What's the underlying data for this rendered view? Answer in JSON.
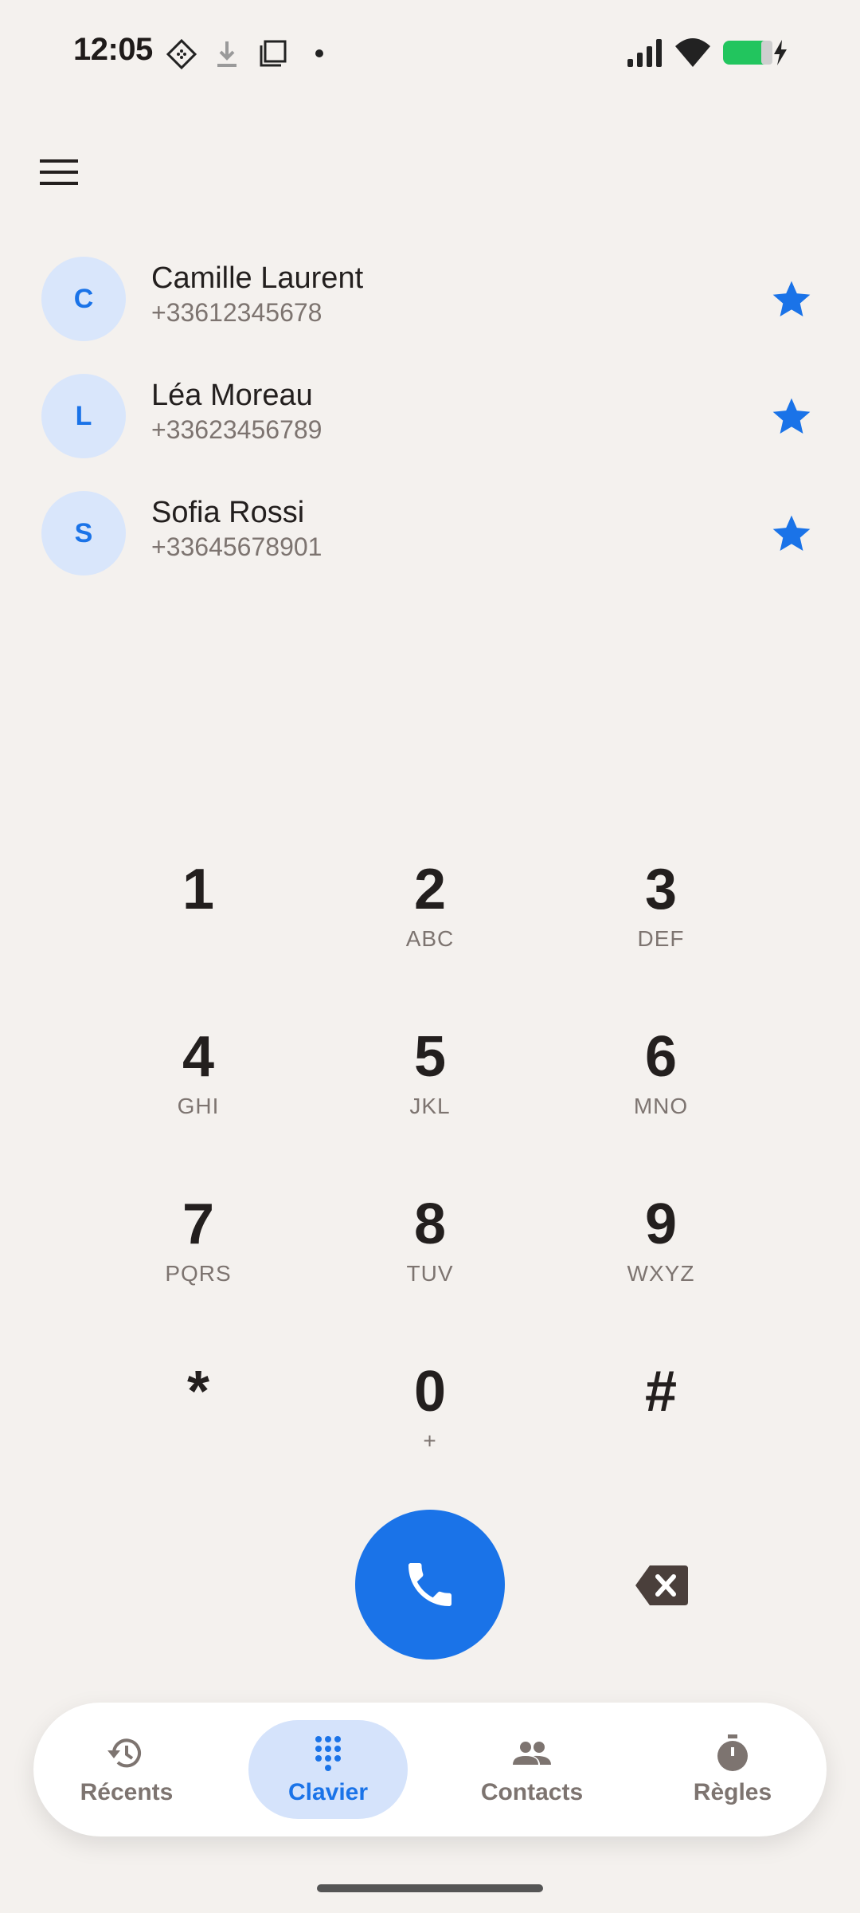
{
  "status_bar": {
    "time": "12:05"
  },
  "favorites": [
    {
      "initial": "C",
      "name": "Camille Laurent",
      "number": "+33612345678"
    },
    {
      "initial": "L",
      "name": "Léa Moreau",
      "number": "+33623456789"
    },
    {
      "initial": "S",
      "name": "Sofia Rossi",
      "number": "+33645678901"
    }
  ],
  "keypad": [
    {
      "digit": "1",
      "letters": ""
    },
    {
      "digit": "2",
      "letters": "ABC"
    },
    {
      "digit": "3",
      "letters": "DEF"
    },
    {
      "digit": "4",
      "letters": "GHI"
    },
    {
      "digit": "5",
      "letters": "JKL"
    },
    {
      "digit": "6",
      "letters": "MNO"
    },
    {
      "digit": "7",
      "letters": "PQRS"
    },
    {
      "digit": "8",
      "letters": "TUV"
    },
    {
      "digit": "9",
      "letters": "WXYZ"
    },
    {
      "digit": "*",
      "letters": ""
    },
    {
      "digit": "0",
      "letters": "+"
    },
    {
      "digit": "#",
      "letters": ""
    }
  ],
  "nav": {
    "recents": "Récents",
    "keypad": "Clavier",
    "contacts": "Contacts",
    "rules": "Règles"
  },
  "colors": {
    "accent": "#1a73e8",
    "background": "#f4f1ee",
    "avatar_bg": "#d9e6fb",
    "active_pill": "#d5e3fb"
  }
}
